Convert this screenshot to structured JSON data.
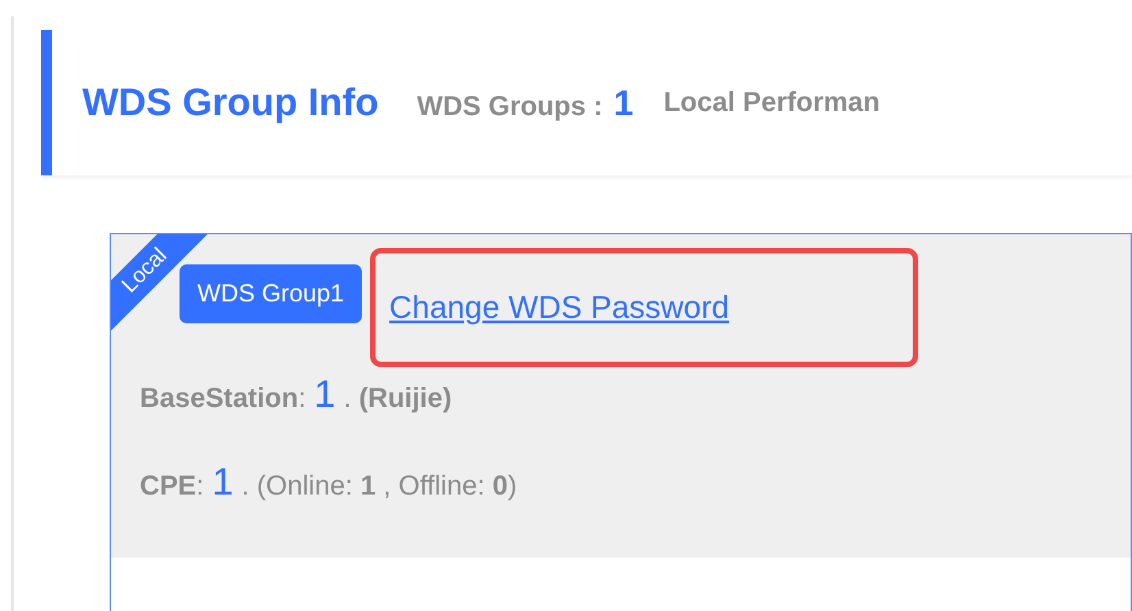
{
  "header": {
    "title": "WDS Group Info",
    "stats": [
      {
        "label": "WDS Groups :",
        "value": "1"
      },
      {
        "label": "Local Performan"
      }
    ]
  },
  "group_card": {
    "ribbon": "Local",
    "group_badge": "WDS Group1",
    "link": "Change WDS Password",
    "link_highlighted": true,
    "rows": [
      {
        "label": "**BaseStation**:",
        "count": "1",
        "detail": ". **(Ruijie)**"
      },
      {
        "label": "**CPE**:",
        "count": "1",
        "detail": ". (Online: **1** , Offline: **0**)"
      }
    ]
  }
}
